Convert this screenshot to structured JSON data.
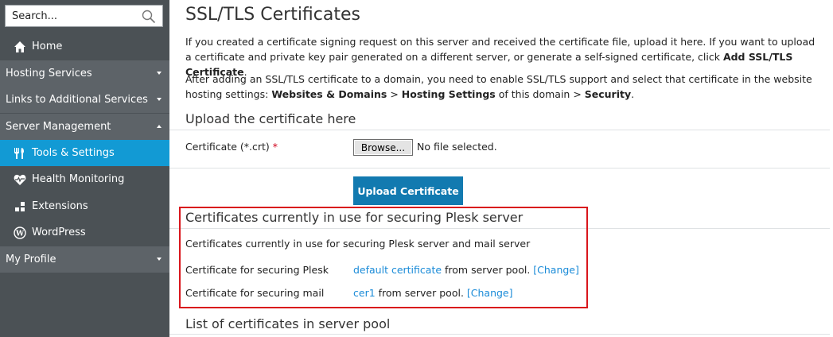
{
  "sidebar": {
    "search_placeholder": "Search...",
    "home": "Home",
    "hosting_services": "Hosting Services",
    "links_additional": "Links to Additional Services",
    "server_management": "Server Management",
    "tools_settings": "Tools & Settings",
    "health_monitoring": "Health Monitoring",
    "extensions": "Extensions",
    "wordpress": "WordPress",
    "my_profile": "My Profile"
  },
  "page": {
    "title": "SSL/TLS Certificates",
    "intro_text": "If you created a certificate signing request on this server and received the certificate file, upload it here. If you want to upload a certificate and private key pair generated on a different server, or generate a self-signed certificate, click ",
    "intro_bold": "Add SSL/TLS Certificate",
    "intro_end": ".",
    "after_text": "After adding an SSL/TLS certificate to a domain, you need to enable SSL/TLS support and select that certificate in the website hosting settings: ",
    "after_bold1": "Websites & Domains",
    "after_sep1": " > ",
    "after_bold2": "Hosting Settings",
    "after_mid": " of this domain > ",
    "after_bold3": "Security",
    "after_end": "."
  },
  "upload_section": {
    "title": "Upload the certificate here",
    "cert_label": "Certificate (*.crt)",
    "required_mark": "*",
    "browse_label": "Browse...",
    "no_file": "No file selected.",
    "upload_button": "Upload Certificate"
  },
  "in_use_section": {
    "title": "Certificates currently in use for securing Plesk server",
    "description": "Certificates currently in use for securing Plesk server and mail server",
    "plesk_label": "Certificate for securing Plesk",
    "plesk_link": "default certificate",
    "plesk_suffix": " from server pool. ",
    "plesk_change": "[Change]",
    "mail_label": "Certificate for securing mail",
    "mail_link": "cer1",
    "mail_suffix": " from server pool. ",
    "mail_change": "[Change]"
  },
  "pool_section": {
    "title": "List of certificates in server pool"
  },
  "colors": {
    "sidebar_bg": "#4b5155",
    "section_bg": "#5d6368",
    "active_bg": "#129ad4",
    "button_bg": "#127ab0",
    "link": "#1a8bd8",
    "highlight_border": "#d9161c"
  }
}
